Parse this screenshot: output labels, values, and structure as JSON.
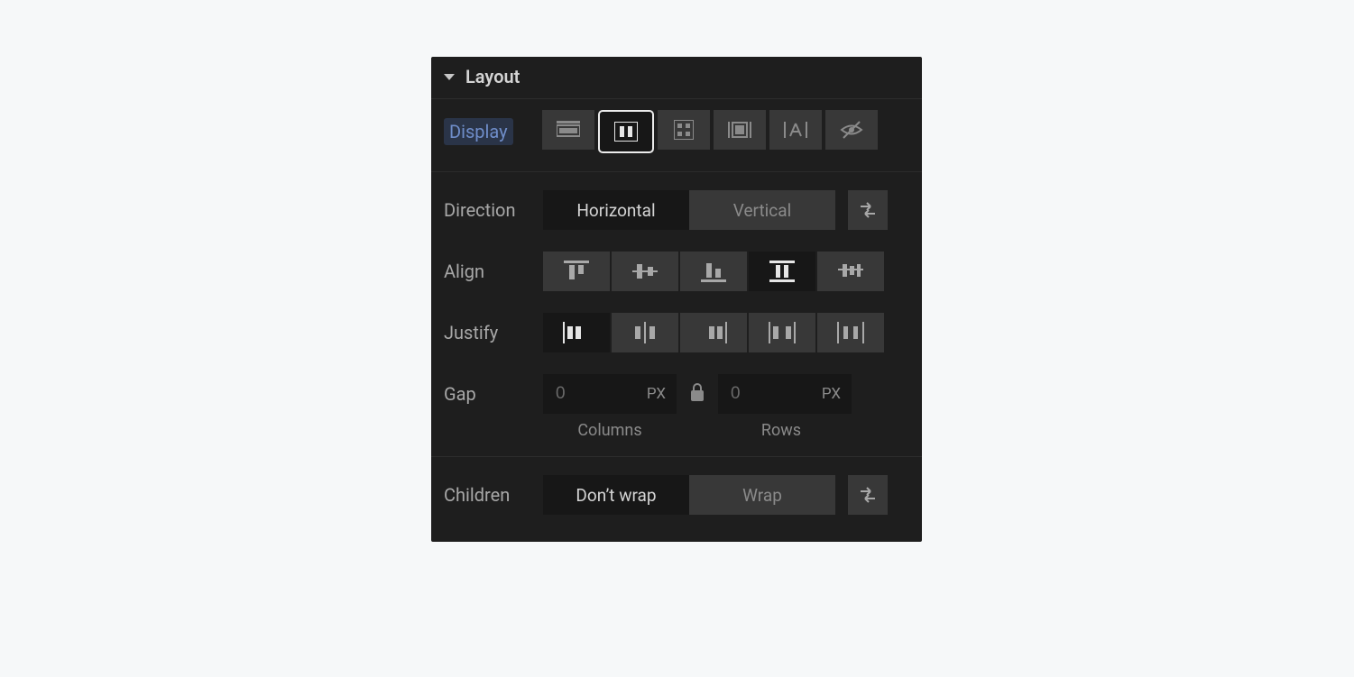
{
  "title": "Layout",
  "displayLabel": "Display",
  "display": {
    "options": [
      "block",
      "flex",
      "grid",
      "inline-block",
      "inline",
      "none"
    ],
    "selected": "flex"
  },
  "directionLabel": "Direction",
  "direction": {
    "options": [
      "Horizontal",
      "Vertical"
    ],
    "selected": "Horizontal"
  },
  "alignLabel": "Align",
  "align": {
    "options": [
      "flex-start",
      "center",
      "flex-end",
      "stretch",
      "baseline"
    ],
    "selected": "stretch"
  },
  "justifyLabel": "Justify",
  "justify": {
    "options": [
      "flex-start",
      "center",
      "flex-end",
      "space-between",
      "space-around"
    ],
    "selected": "flex-start"
  },
  "gapLabel": "Gap",
  "gap": {
    "columns": {
      "value": "",
      "placeholder": "0",
      "unit": "PX",
      "sub": "Columns"
    },
    "rows": {
      "value": "",
      "placeholder": "0",
      "unit": "PX",
      "sub": "Rows"
    }
  },
  "childrenLabel": "Children",
  "children": {
    "options": [
      "Don’t wrap",
      "Wrap"
    ],
    "selected": "Don’t wrap"
  }
}
